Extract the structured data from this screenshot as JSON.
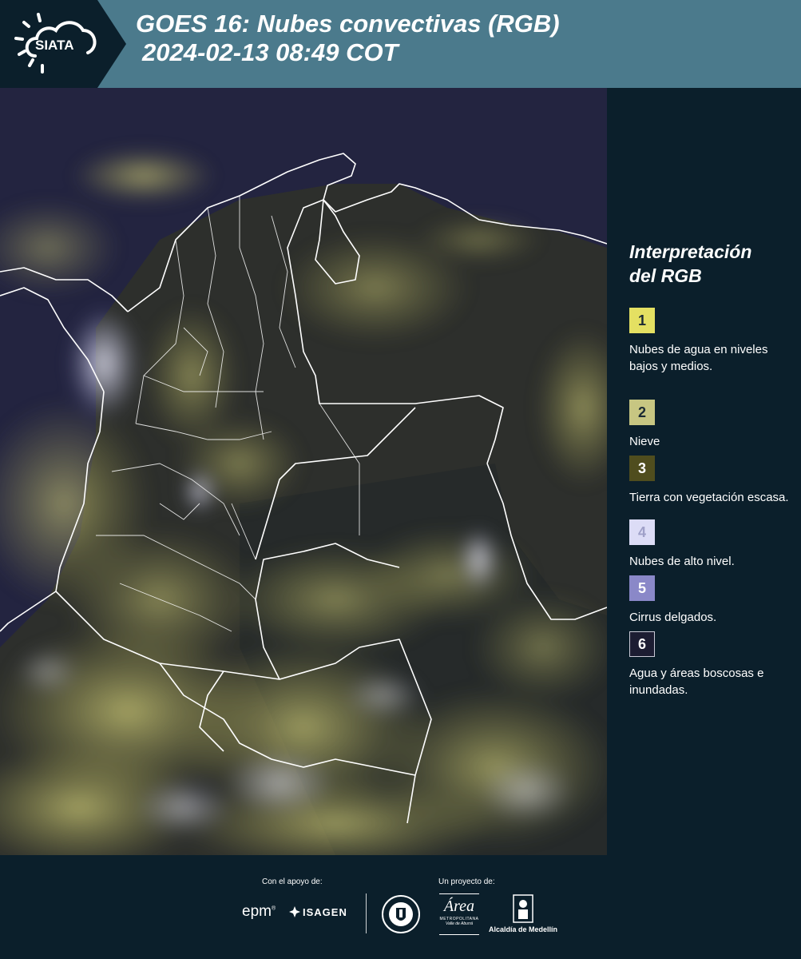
{
  "header": {
    "logo_text": "SIATA",
    "title_line1": "GOES 16: Nubes convectivas (RGB)",
    "title_line2": "2024-02-13 08:49 COT"
  },
  "colors": {
    "header_bg": "#4b7a8c",
    "page_bg": "#0b1f2b",
    "cloud_low": "#c9c55a",
    "cloud_high": "#c9c8ee",
    "water": "#24253f",
    "border": "#ffffff"
  },
  "legend": {
    "title_line1": "Interpretación",
    "title_line2": "del RGB",
    "items": [
      {
        "number": "1",
        "color": "#e4e062",
        "text": "Nubes de agua en niveles bajos y medios."
      },
      {
        "number": "2",
        "color": "#c7c682",
        "text": "Nieve"
      },
      {
        "number": "3",
        "color": "#4f4d1e",
        "text": "Tierra con vegetación escasa."
      },
      {
        "number": "4",
        "color": "#dcdcf6",
        "text": "Nubes de alto nivel."
      },
      {
        "number": "5",
        "color": "#8a88c8",
        "text": "Cirrus delgados."
      },
      {
        "number": "6",
        "color": "#1c1d32",
        "text": "Agua y áreas boscosas e inundadas."
      }
    ]
  },
  "footer": {
    "support_label": "Con el apoyo de:",
    "project_label": "Un proyecto de:",
    "sponsor_1": "epm",
    "sponsor_2": "ISAGEN",
    "partner_1_line1": "Área",
    "partner_1_line2": "METROPOLITANA",
    "partner_1_line3": "Valle de Aburrá",
    "partner_2": "Alcaldía de Medellín"
  }
}
